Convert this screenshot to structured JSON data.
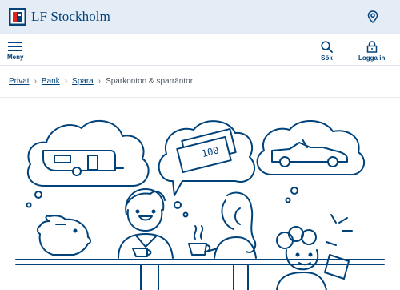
{
  "brand": {
    "name": "LF Stockholm",
    "colors": {
      "primary": "#00427a",
      "accent": "#e2231a",
      "bar": "#e4ecf6"
    }
  },
  "header": {
    "location_icon": "location-pin-icon"
  },
  "nav": {
    "menu_label": "Meny",
    "search_label": "Sök",
    "login_label": "Logga in"
  },
  "breadcrumb": {
    "items": [
      "Privat",
      "Bank",
      "Spara"
    ],
    "current": "Sparkonton & sparräntor"
  },
  "illustration": {
    "banknote_text": "100"
  }
}
